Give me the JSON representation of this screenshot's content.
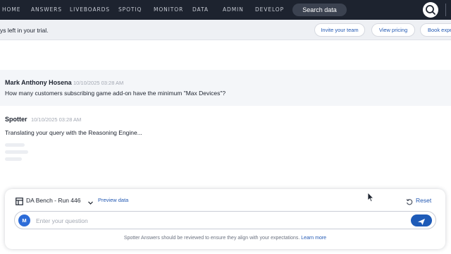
{
  "nav": {
    "items": [
      "HOME",
      "ANSWERS",
      "LIVEBOARDS",
      "SPOTIQ",
      "MONITOR",
      "DATA",
      "ADMIN",
      "DEVELOP"
    ],
    "search_label": "Search data",
    "search_icon": "search-icon"
  },
  "trial": {
    "text": "ys left in your trial.",
    "buttons": [
      "Invite your team",
      "View pricing",
      "Book expe"
    ]
  },
  "conversation": {
    "user_message": {
      "author": "Mark Anthony Hosena",
      "time": "10/10/2025 03:28 AM",
      "text": "How many customers subscribing game add-on have the minimum \"Max Devices\"?"
    },
    "spotter_message": {
      "author": "Spotter",
      "time": "10/10/2025 03:28 AM",
      "text": "Translating your query with the Reasoning Engine..."
    }
  },
  "composer": {
    "datasource": "DA Bench - Run 446",
    "preview_link": "Preview data",
    "reset_label": "Reset",
    "avatar_initial": "M",
    "placeholder": "Enter your question",
    "disclaimer": "Spotter Answers should be reviewed to ensure they align with your expectations.",
    "learn_more": "Learn more"
  },
  "colors": {
    "nav_bg": "#1d232f",
    "accent": "#2359b3",
    "send_button": "#1e5bb8"
  }
}
